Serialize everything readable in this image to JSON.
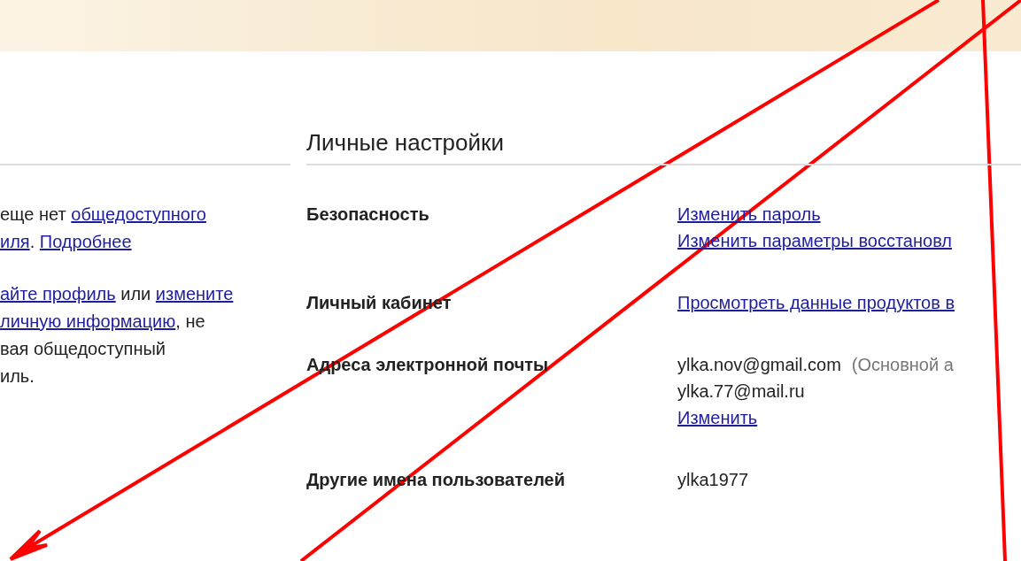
{
  "profile_note": {
    "paragraphs": [
      {
        "lines": [
          [
            {
              "kind": "text",
              "text": "еще нет "
            },
            {
              "kind": "link",
              "text": "общедоступного"
            }
          ],
          [
            {
              "kind": "link",
              "text": "иля"
            },
            {
              "kind": "text",
              "text": ". "
            },
            {
              "kind": "link",
              "text": "Подробнее"
            }
          ]
        ]
      },
      {
        "lines": [
          [
            {
              "kind": "link",
              "text": "айте профиль"
            },
            {
              "kind": "text",
              "text": " или "
            },
            {
              "kind": "link",
              "text": "измените"
            }
          ],
          [
            {
              "kind": "link",
              "text": "личную информацию"
            },
            {
              "kind": "text",
              "text": ", не"
            }
          ],
          [
            {
              "kind": "text",
              "text": "вая общедоступный"
            }
          ],
          [
            {
              "kind": "text",
              "text": "иль."
            }
          ]
        ]
      }
    ]
  },
  "personal_settings": {
    "title": "Личные настройки",
    "rows": [
      {
        "label": "Безопасность",
        "lines": [
          [
            {
              "kind": "link",
              "text": "Изменить пароль"
            }
          ],
          [
            {
              "kind": "link",
              "text": "Изменить параметры восстановл"
            }
          ]
        ]
      },
      {
        "label": "Личный кабинет",
        "lines": [
          [
            {
              "kind": "link",
              "text": "Просмотреть данные продуктов в"
            }
          ]
        ]
      },
      {
        "label": "Адреса электронной почты",
        "lines": [
          [
            {
              "kind": "text",
              "text": "ylka.nov@gmail.com"
            },
            {
              "kind": "note",
              "text": "(Основной а"
            }
          ],
          [
            {
              "kind": "text",
              "text": "ylka.77@mail.ru"
            }
          ],
          [
            {
              "kind": "link",
              "text": "Изменить"
            }
          ]
        ]
      },
      {
        "label": "Другие имена пользователей",
        "lines": [
          [
            {
              "kind": "text",
              "text": "ylka1977"
            }
          ]
        ]
      }
    ]
  }
}
